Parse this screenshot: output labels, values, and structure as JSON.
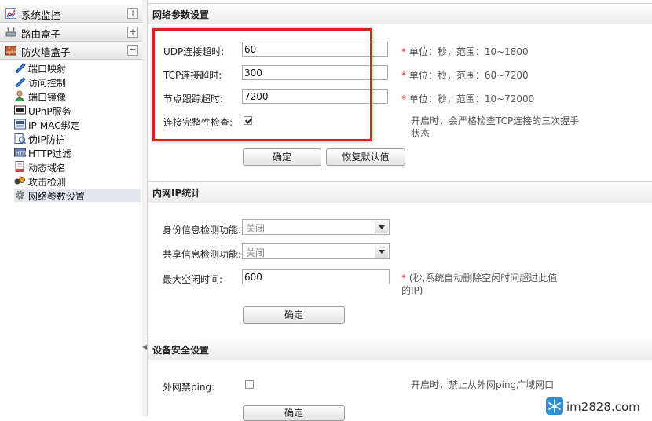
{
  "sidebar": {
    "groups": [
      {
        "label": "系统监控",
        "toggle": "+",
        "icon": "chart-icon"
      },
      {
        "label": "路由盒子",
        "toggle": "+",
        "icon": "router-icon"
      },
      {
        "label": "防火墙盒子",
        "toggle": "−",
        "icon": "firewall-icon"
      }
    ],
    "items": [
      {
        "label": "端口映射",
        "icon": "port-map-icon"
      },
      {
        "label": "访问控制",
        "icon": "access-control-icon"
      },
      {
        "label": "端口镜像",
        "icon": "port-mirror-icon"
      },
      {
        "label": "UPnP服务",
        "icon": "upnp-icon"
      },
      {
        "label": "IP-MAC绑定",
        "icon": "ip-mac-icon"
      },
      {
        "label": "伪IP防护",
        "icon": "fake-ip-icon"
      },
      {
        "label": "HTTP过滤",
        "icon": "http-filter-icon"
      },
      {
        "label": "动态域名",
        "icon": "ddns-icon"
      },
      {
        "label": "攻击检测",
        "icon": "attack-detect-icon"
      },
      {
        "label": "网络参数设置",
        "icon": "gear-icon",
        "selected": true
      }
    ]
  },
  "net_params": {
    "title": "网络参数设置",
    "udp_label": "UDP连接超时:",
    "udp_value": "60",
    "udp_hint_star": "*",
    "udp_hint": " 单位：秒，范围：10~1800",
    "tcp_label": "TCP连接超时:",
    "tcp_value": "300",
    "tcp_hint_star": "*",
    "tcp_hint": " 单位：秒，范围：60~7200",
    "track_label": "节点跟踪超时:",
    "track_value": "7200",
    "track_hint_star": "*",
    "track_hint": " 单位：秒，范围：10~72000",
    "integrity_label": "连接完整性检查:",
    "integrity_checked": true,
    "integrity_note": "开启时，会严格检查TCP连接的三次握手状态",
    "ok_label": "确定",
    "reset_label": "恢复默认值"
  },
  "lan_ip": {
    "title": "内网IP统计",
    "identity_label": "身份信息检测功能:",
    "identity_value": "关闭",
    "share_label": "共享信息检测功能:",
    "share_value": "关闭",
    "idle_label": "最大空闲时间:",
    "idle_value": "600",
    "idle_hint_star": "*",
    "idle_hint": " (秒,系统自动删除空闲时间超过此值的IP)",
    "ok_label": "确定"
  },
  "device_security": {
    "title": "设备安全设置",
    "ping_label": "外网禁ping:",
    "ping_checked": false,
    "ping_note": "开启时，禁止从外网ping广域网口",
    "ok_label": "确定"
  },
  "watermark": {
    "text": "im2828.com",
    "icon": "snowflake-logo-icon"
  },
  "colors": {
    "highlight": "#d9221f",
    "required_star": "#d33333",
    "selected_row": "#e3e7ee"
  }
}
